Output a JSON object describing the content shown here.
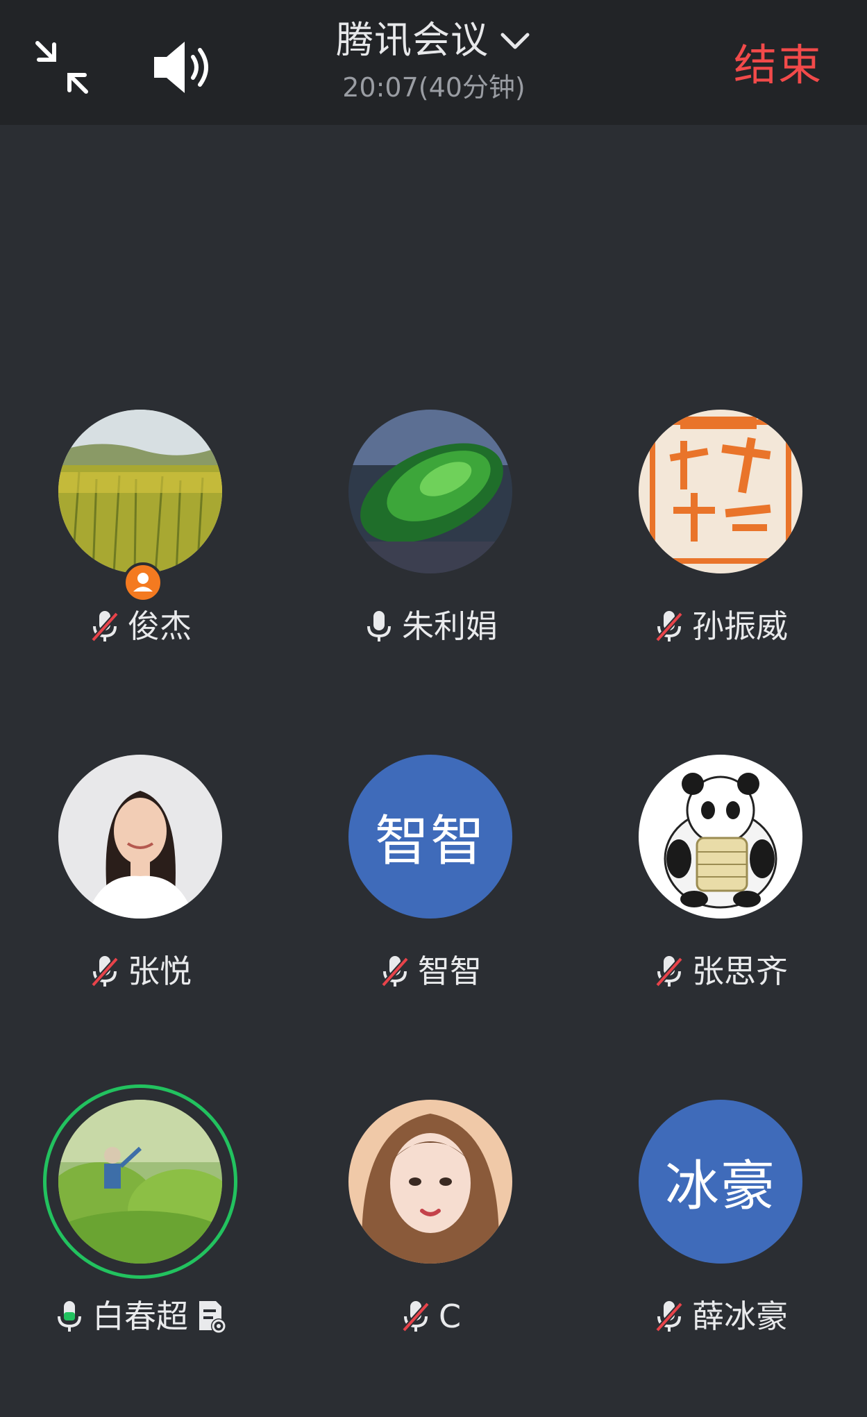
{
  "header": {
    "title": "腾讯会议",
    "time": "20:07(40分钟)",
    "end_label": "结束",
    "icons": {
      "minimize": "minimize-arrows-icon",
      "speaker": "speaker-icon",
      "dropdown": "chevron-down-icon"
    }
  },
  "colors": {
    "background": "#2b2e33",
    "topbar": "#222427",
    "end": "#f24a4a",
    "avatar_blue": "#3f6bba",
    "speaking": "#22c25f",
    "host_badge": "#f47a20",
    "muted_slash": "#e8434a"
  },
  "participants": [
    {
      "name": "俊杰",
      "mic": "muted",
      "avatar_type": "photo",
      "avatar_desc": "rapeseed-field",
      "host": true
    },
    {
      "name": "朱利娟",
      "mic": "on",
      "avatar_type": "photo",
      "avatar_desc": "green-leaves"
    },
    {
      "name": "孙振威",
      "mic": "muted",
      "avatar_type": "photo",
      "avatar_desc": "orange-calligraphy"
    },
    {
      "name": "张悦",
      "mic": "muted",
      "avatar_type": "photo",
      "avatar_desc": "woman-portrait"
    },
    {
      "name": "智智",
      "mic": "muted",
      "avatar_type": "text",
      "avatar_text": "智智"
    },
    {
      "name": "张思齐",
      "mic": "muted",
      "avatar_type": "photo",
      "avatar_desc": "panda-illustration"
    },
    {
      "name": "白春超",
      "mic": "on-speaking",
      "avatar_type": "photo",
      "avatar_desc": "tea-field",
      "speaking": true,
      "extra_icon": "document-record-icon"
    },
    {
      "name": "C",
      "mic": "muted",
      "avatar_type": "photo",
      "avatar_desc": "girl-portrait"
    },
    {
      "name": "薛冰豪",
      "mic": "muted",
      "avatar_type": "text",
      "avatar_text": "冰豪"
    }
  ]
}
